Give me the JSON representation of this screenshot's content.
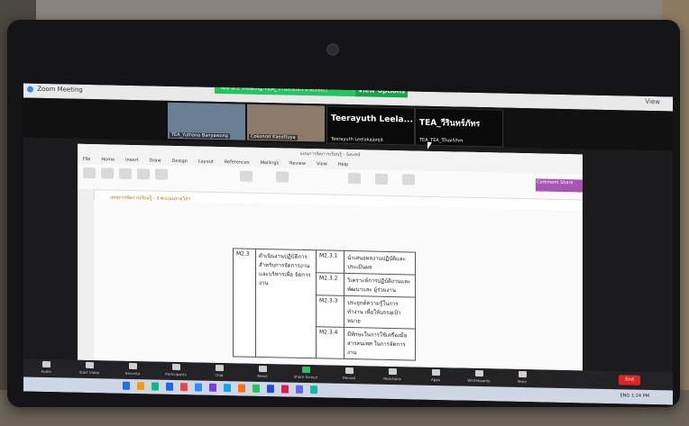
{
  "zoom": {
    "window_title": "Zoom Meeting",
    "share_banner": "You are viewing TEA_วีรินทร์ภัทร's screen",
    "view_options": "View Options",
    "view_label": "View"
  },
  "participants": [
    {
      "name": "TEA_Yuthana Banyawong"
    },
    {
      "name": "Cokonrat Kaeottuya"
    },
    {
      "name": "Teerayuth Leelakajonjit",
      "big": "Teerayuth  Leela..."
    },
    {
      "name": "TEA_TEA_วีรินทร์ภัทร",
      "big": "TEA_วีรินทร์ภัทร"
    }
  ],
  "word": {
    "title": "แผนการจัดการเรียนรู้ - Saved",
    "tabs": [
      "File",
      "Home",
      "Insert",
      "Draw",
      "Design",
      "Layout",
      "References",
      "Mailings",
      "Review",
      "View",
      "Help"
    ],
    "comment_flag": "Comment  Share",
    "breadcrumb": "แผนการจัดการเรียนรู้ - 3  คะแนนรายวิชา",
    "table": [
      {
        "code": "M2.3",
        "standard": "ดำเนินงานปฏิบัติการ สำหรับการจัดการงาน และบริหารเพื่อ จัดการงาน",
        "sub_code": "M2.3.1",
        "desc": "นำเสนอผลงานปฏิบัติและ ประเมินผล"
      },
      {
        "code": "",
        "standard": "",
        "sub_code": "M2.3.2",
        "desc": "วิเคราะห์การปฏิบัติงานและพัฒนาและ ผู้ร่วมงาน"
      },
      {
        "code": "",
        "standard": "",
        "sub_code": "M2.3.3",
        "desc": "ประยุกต์ความรู้ในการทำงาน เพื่อให้บรรลุเป้าหมาย"
      },
      {
        "code": "",
        "standard": "",
        "sub_code": "M2.3.4",
        "desc": "มีทักษะในการใช้เครื่องมือสารสนเทศ ในการจัดการงาน"
      }
    ]
  },
  "toolbar": [
    {
      "label": "Audio",
      "icon": "microphone-icon"
    },
    {
      "label": "Start Video",
      "icon": "video-icon"
    },
    {
      "label": "Security",
      "icon": "shield-icon"
    },
    {
      "label": "Participants",
      "icon": "people-icon"
    },
    {
      "label": "Chat",
      "icon": "chat-icon"
    },
    {
      "label": "React",
      "icon": "emoji-icon"
    },
    {
      "label": "Share Screen",
      "icon": "share-screen-icon"
    },
    {
      "label": "Record",
      "icon": "record-icon"
    },
    {
      "label": "Reactions",
      "icon": "reactions-icon"
    },
    {
      "label": "Apps",
      "icon": "apps-icon"
    },
    {
      "label": "Whiteboards",
      "icon": "whiteboard-icon"
    },
    {
      "label": "More",
      "icon": "more-icon"
    }
  ],
  "end_label": "End",
  "taskbar": {
    "tray_text": "ENG  1:24 PM"
  }
}
